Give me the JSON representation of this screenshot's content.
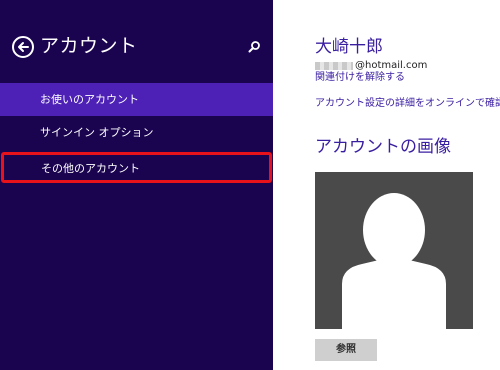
{
  "pane": {
    "title": "アカウント",
    "back_icon": "back-arrow-circle-icon",
    "search_icon": "search-icon",
    "items": [
      {
        "label": "お使いのアカウント",
        "state": "selected"
      },
      {
        "label": "サインイン オプション",
        "state": "normal"
      },
      {
        "label": "その他のアカウント",
        "state": "highlighted"
      }
    ]
  },
  "account": {
    "name": "大崎十郎",
    "email_domain": "@hotmail.com",
    "disconnect_link": "関連付けを解除する",
    "online_settings_link": "アカウント設定の詳細をオンラインで確認する"
  },
  "picture": {
    "title": "アカウントの画像",
    "avatar_icon": "default-user-avatar-icon",
    "browse_button": "参照"
  },
  "colors": {
    "pane_background": "#1a0450",
    "selected_item": "#4d21b5",
    "highlight_border": "#e8121a",
    "accent_text": "#3a1ea0"
  }
}
